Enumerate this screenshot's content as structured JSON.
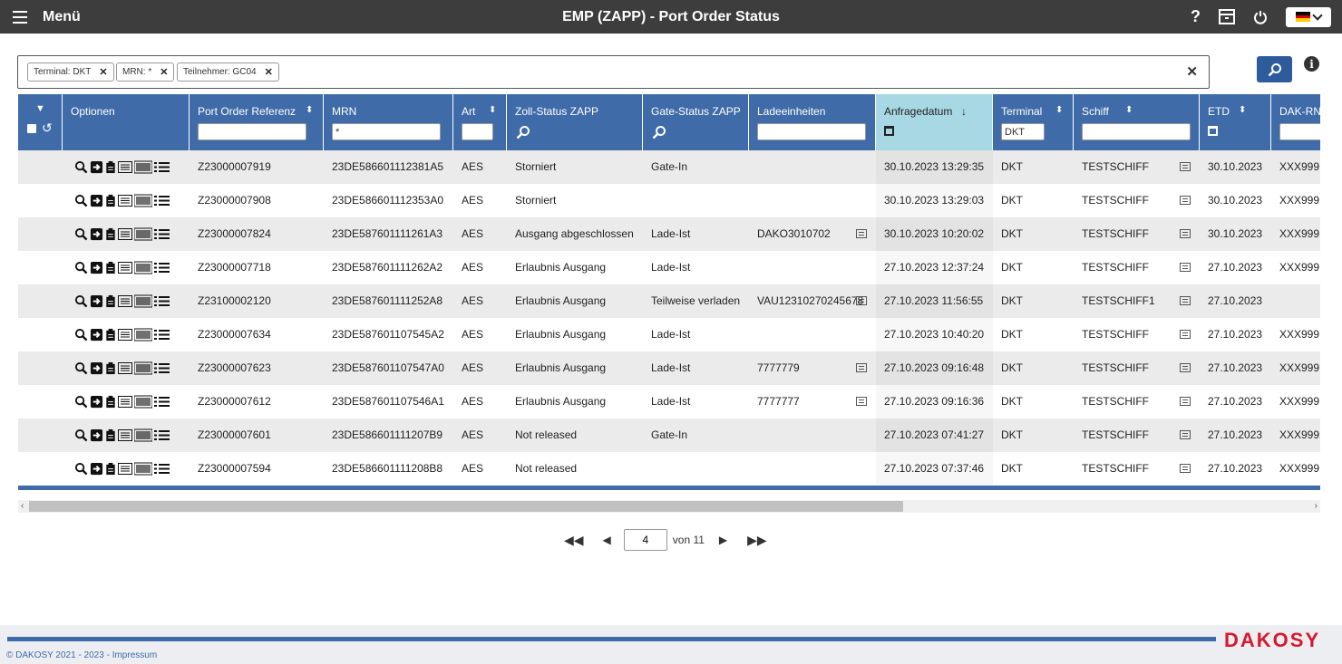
{
  "header": {
    "menu_label": "Menü",
    "title": "EMP (ZAPP) - Port Order Status",
    "help_label": "?",
    "icons": [
      "menu-icon",
      "help-icon",
      "archive-icon",
      "power-icon",
      "flag-de-icon"
    ]
  },
  "filters": {
    "chips": [
      {
        "label": "Terminal: DKT"
      },
      {
        "label": "MRN: *"
      },
      {
        "label": "Teilnehmer: GC04"
      }
    ],
    "clear_icon": "close-icon",
    "search_icon": "search-icon",
    "info_icon": "info-icon",
    "info_label": "i"
  },
  "table": {
    "columns": {
      "optionen": "Optionen",
      "ref": "Port Order Referenz",
      "mrn": "MRN",
      "art": "Art",
      "zoll": "Zoll-Status ZAPP",
      "gate": "Gate-Status ZAPP",
      "lade": "Ladeeinheiten",
      "anfrage": "Anfragedatum",
      "terminal": "Terminal",
      "schiff": "Schiff",
      "etd": "ETD",
      "dak": "DAK-RN"
    },
    "filter_values": {
      "mrn": "*",
      "terminal": "DKT"
    },
    "sorted_column": "Anfragedatum",
    "sort_direction": "descending",
    "rows": [
      {
        "ref": "Z23000007919",
        "mrn": "23DE586601112381A5",
        "art": "AES",
        "zoll": "Storniert",
        "gate": "Gate-In",
        "lade": "",
        "anfrage": "30.10.2023 13:29:35",
        "terminal": "DKT",
        "schiff": "TESTSCHIFF",
        "etd": "30.10.2023",
        "dak": "XXX999"
      },
      {
        "ref": "Z23000007908",
        "mrn": "23DE586601112353A0",
        "art": "AES",
        "zoll": "Storniert",
        "gate": "",
        "lade": "",
        "anfrage": "30.10.2023 13:29:03",
        "terminal": "DKT",
        "schiff": "TESTSCHIFF",
        "etd": "30.10.2023",
        "dak": "XXX999"
      },
      {
        "ref": "Z23000007824",
        "mrn": "23DE587601111261A3",
        "art": "AES",
        "zoll": "Ausgang abgeschlossen",
        "gate": "Lade-Ist",
        "lade": "DAKO3010702",
        "anfrage": "30.10.2023 10:20:02",
        "terminal": "DKT",
        "schiff": "TESTSCHIFF",
        "etd": "30.10.2023",
        "dak": "XXX999"
      },
      {
        "ref": "Z23000007718",
        "mrn": "23DE587601111262A2",
        "art": "AES",
        "zoll": "Erlaubnis Ausgang",
        "gate": "Lade-Ist",
        "lade": "",
        "anfrage": "27.10.2023 12:37:24",
        "terminal": "DKT",
        "schiff": "TESTSCHIFF",
        "etd": "27.10.2023",
        "dak": "XXX999"
      },
      {
        "ref": "Z23100002120",
        "mrn": "23DE587601111252A8",
        "art": "AES",
        "zoll": "Erlaubnis Ausgang",
        "gate": "Teilweise verladen",
        "lade": "VAU12310270245678",
        "anfrage": "27.10.2023 11:56:55",
        "terminal": "DKT",
        "schiff": "TESTSCHIFF1",
        "etd": "27.10.2023",
        "dak": ""
      },
      {
        "ref": "Z23000007634",
        "mrn": "23DE587601107545A2",
        "art": "AES",
        "zoll": "Erlaubnis Ausgang",
        "gate": "Lade-Ist",
        "lade": "",
        "anfrage": "27.10.2023 10:40:20",
        "terminal": "DKT",
        "schiff": "TESTSCHIFF",
        "etd": "27.10.2023",
        "dak": "XXX999"
      },
      {
        "ref": "Z23000007623",
        "mrn": "23DE587601107547A0",
        "art": "AES",
        "zoll": "Erlaubnis Ausgang",
        "gate": "Lade-Ist",
        "lade": "7777779",
        "anfrage": "27.10.2023 09:16:48",
        "terminal": "DKT",
        "schiff": "TESTSCHIFF",
        "etd": "27.10.2023",
        "dak": "XXX999"
      },
      {
        "ref": "Z23000007612",
        "mrn": "23DE587601107546A1",
        "art": "AES",
        "zoll": "Erlaubnis Ausgang",
        "gate": "Lade-Ist",
        "lade": "7777777",
        "anfrage": "27.10.2023 09:16:36",
        "terminal": "DKT",
        "schiff": "TESTSCHIFF",
        "etd": "27.10.2023",
        "dak": "XXX999"
      },
      {
        "ref": "Z23000007601",
        "mrn": "23DE586601111207B9",
        "art": "AES",
        "zoll": "Not released",
        "gate": "Gate-In",
        "lade": "",
        "anfrage": "27.10.2023 07:41:27",
        "terminal": "DKT",
        "schiff": "TESTSCHIFF",
        "etd": "27.10.2023",
        "dak": "XXX999"
      },
      {
        "ref": "Z23000007594",
        "mrn": "23DE586601111208B8",
        "art": "AES",
        "zoll": "Not released",
        "gate": "",
        "lade": "",
        "anfrage": "27.10.2023 07:37:46",
        "terminal": "DKT",
        "schiff": "TESTSCHIFF",
        "etd": "27.10.2023",
        "dak": "XXX999"
      }
    ]
  },
  "pager": {
    "current_page": "4",
    "of_label": "von 11"
  },
  "footer": {
    "copyright": "© DAKOSY 2021 - 2023 - Impressum",
    "brand": "DAKOSY"
  },
  "colors": {
    "topbar": "#3d3d3d",
    "header": "#3f6ba8",
    "sorted_header": "#a8d8e4",
    "row_alt": "#ebebeb",
    "brand": "#d7192d"
  }
}
